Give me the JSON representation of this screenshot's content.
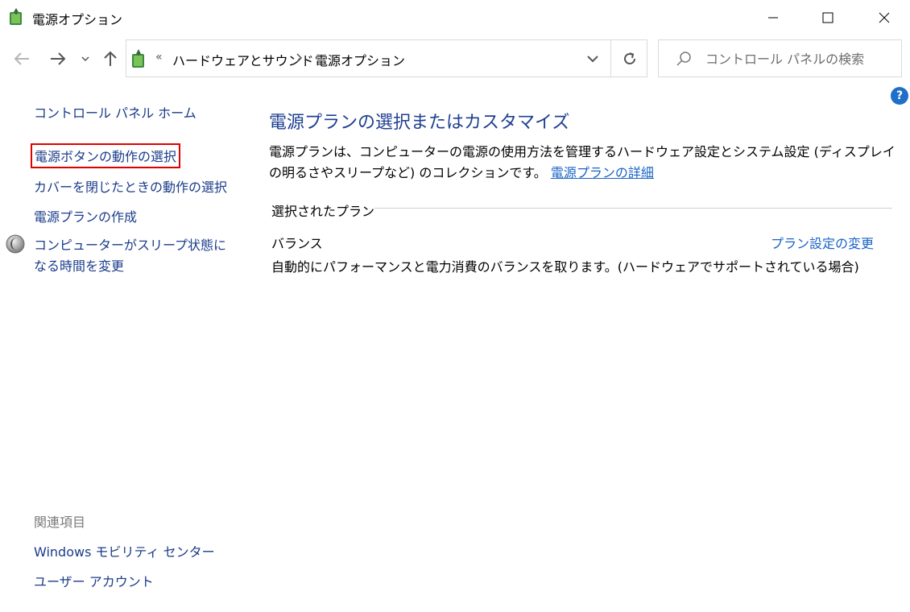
{
  "window": {
    "title": "電源オプション"
  },
  "addressbar": {
    "overflow": "«",
    "breadcrumbs": [
      "ハードウェアとサウンド",
      "電源オプション"
    ]
  },
  "search": {
    "placeholder": "コントロール パネルの検索"
  },
  "help": {
    "label": "?"
  },
  "sidebar": {
    "home": "コントロール パネル ホーム",
    "items": [
      "電源ボタンの動作の選択",
      "カバーを閉じたときの動作の選択",
      "電源プランの作成",
      "コンピューターがスリープ状態になる時間を変更"
    ],
    "related_header": "関連項目",
    "related": [
      "Windows モビリティ センター",
      "ユーザー アカウント"
    ]
  },
  "main": {
    "title": "電源プランの選択またはカスタマイズ",
    "description": "電源プランは、コンピューターの電源の使用方法を管理するハードウェア設定とシステム設定 (ディスプレイの明るさやスリープなど) のコレクションです。",
    "description_link": "電源プランの詳細",
    "section_label": "選択されたプラン",
    "plan": {
      "name": "バランス",
      "change_link": "プラン設定の変更",
      "description": "自動的にパフォーマンスと電力消費のバランスを取ります。(ハードウェアでサポートされている場合)"
    }
  },
  "colors": {
    "link": "#1a3b8a",
    "accent_link": "#1a63c6",
    "title": "#1e3f91",
    "highlight_border": "#e00000"
  }
}
